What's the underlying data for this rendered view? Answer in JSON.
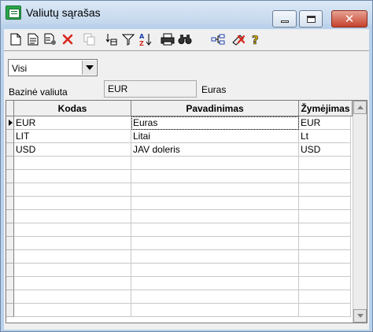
{
  "window": {
    "title": "Valiutų sąrašas",
    "controls": [
      "minimize",
      "maximize",
      "close"
    ]
  },
  "toolbar": {
    "icons": [
      "new-document-icon",
      "edit-document-icon",
      "properties-icon",
      "delete-icon",
      "copy-icon",
      "columns-icon",
      "filter-icon",
      "sort-az-icon",
      "print-icon",
      "find-icon",
      "structure-icon",
      "clear-icon",
      "help-icon"
    ]
  },
  "filter": {
    "value": "Visi"
  },
  "base_currency": {
    "label": "Bazinė valiuta",
    "code": "EUR",
    "name": "Euras"
  },
  "grid": {
    "columns": [
      "Kodas",
      "Pavadinimas",
      "Žymėjimas"
    ],
    "rows": [
      {
        "code": "EUR",
        "name": "Euras",
        "symbol": "EUR"
      },
      {
        "code": "LIT",
        "name": "Litai",
        "symbol": "Lt"
      },
      {
        "code": "USD",
        "name": "JAV doleris",
        "symbol": "USD"
      }
    ],
    "empty_rows": 12
  },
  "colors": {
    "accent_icon_green": "#2aa84a",
    "delete_red": "#d9261c",
    "close_red": "#c4422c"
  }
}
